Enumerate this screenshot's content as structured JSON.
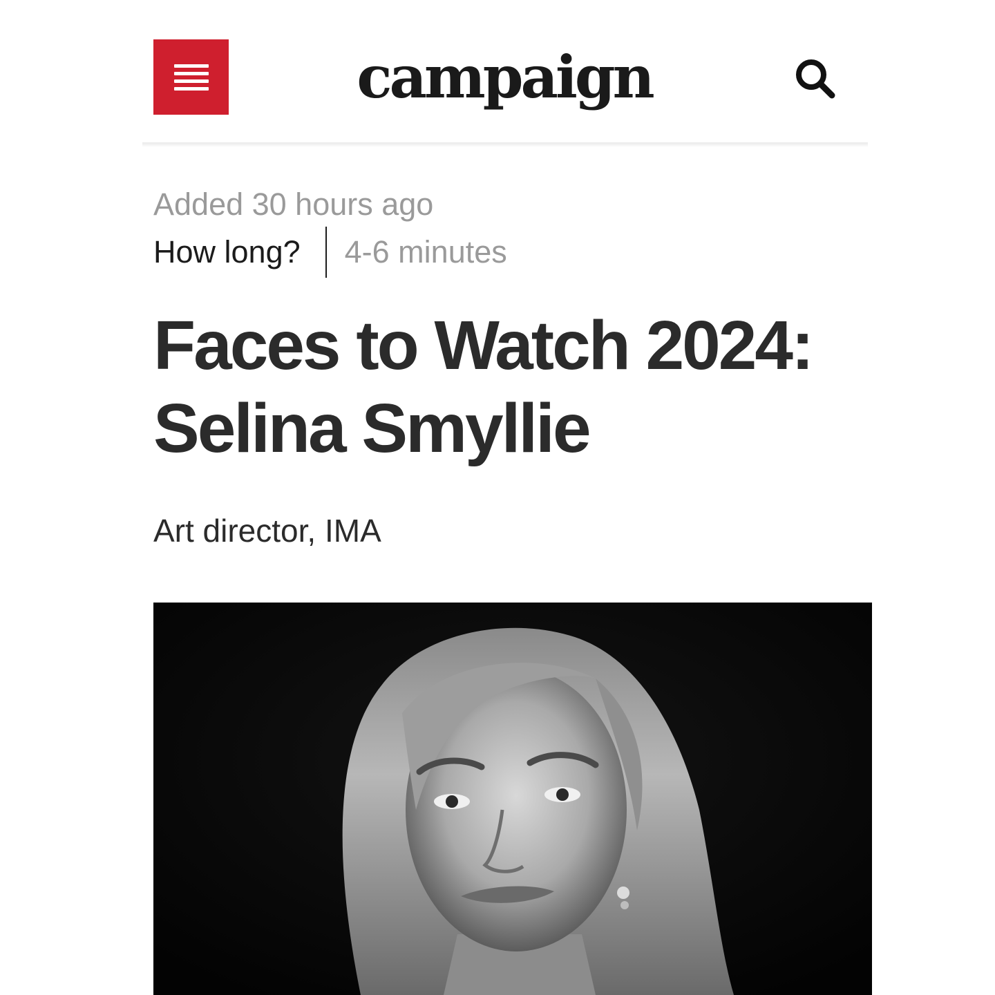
{
  "header": {
    "logo_text": "campaign",
    "menu_icon": "hamburger-menu-icon",
    "search_icon": "search-icon",
    "brand_color": "#cf1f2e"
  },
  "article": {
    "added": "Added 30 hours ago",
    "how_long_label": "How long?",
    "how_long_value": "4-6 minutes",
    "title_line1": "Faces to Watch 2024:",
    "title_line2": "Selina Smyllie",
    "subtitle": "Art director, IMA"
  }
}
